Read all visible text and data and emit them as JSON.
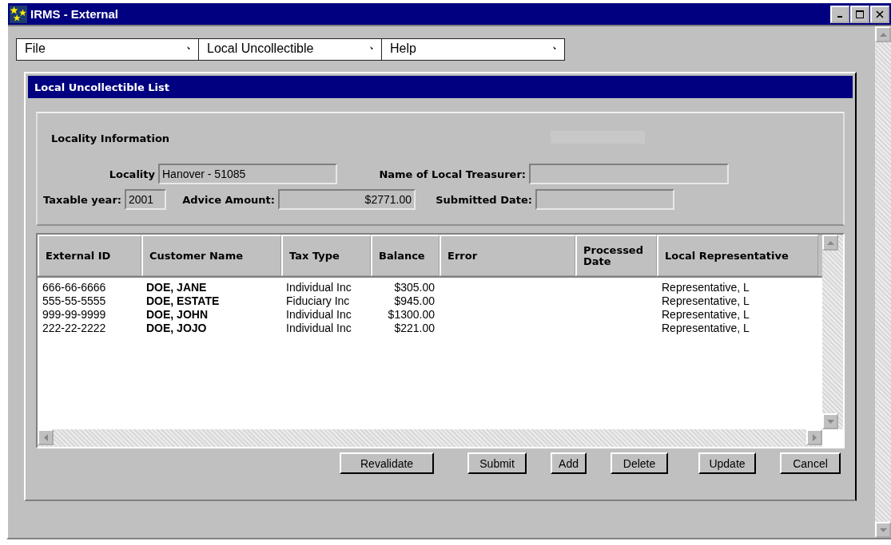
{
  "window": {
    "title": "IRMS - External"
  },
  "menus": [
    {
      "label": "File"
    },
    {
      "label": "Local Uncollectible"
    },
    {
      "label": "Help"
    }
  ],
  "panel": {
    "title": "Local Uncollectible List"
  },
  "locality_info": {
    "title": "Locality Information",
    "fields": [
      {
        "label": "Locality",
        "value": "Hanover - 51085"
      },
      {
        "label": "Name of Local Treasurer:"
      },
      {
        "label": "Taxable year:",
        "value": "2001"
      },
      {
        "label": "Advice Amount:",
        "value": "$2771.00"
      },
      {
        "label": "Submitted Date:"
      }
    ]
  },
  "table": {
    "columns": [
      "External ID",
      "Customer Name",
      "Tax Type",
      "Balance",
      "Error",
      "Processed Date",
      "Local Representative"
    ],
    "rows": [
      {
        "external_id": "666-66-6666",
        "customer_name": "DOE, JANE",
        "tax_type": "Individual Inc",
        "balance": "$305.00",
        "local_representative": "Representative, L"
      },
      {
        "external_id": "555-55-5555",
        "customer_name": "DOE, ESTATE",
        "tax_type": "Fiduciary Inc",
        "balance": "$945.00",
        "local_representative": "Representative, L"
      },
      {
        "external_id": "999-99-9999",
        "customer_name": "DOE, JOHN",
        "tax_type": "Individual Inc",
        "balance": "$1300.00",
        "local_representative": "Representative, L"
      },
      {
        "external_id": "222-22-2222",
        "customer_name": "DOE, JOJO",
        "tax_type": "Individual Inc",
        "balance": "$221.00",
        "local_representative": "Representative, L"
      }
    ]
  },
  "buttons": [
    "Revalidate",
    "Submit",
    "Add",
    "Delete",
    "Update",
    "Cancel"
  ]
}
